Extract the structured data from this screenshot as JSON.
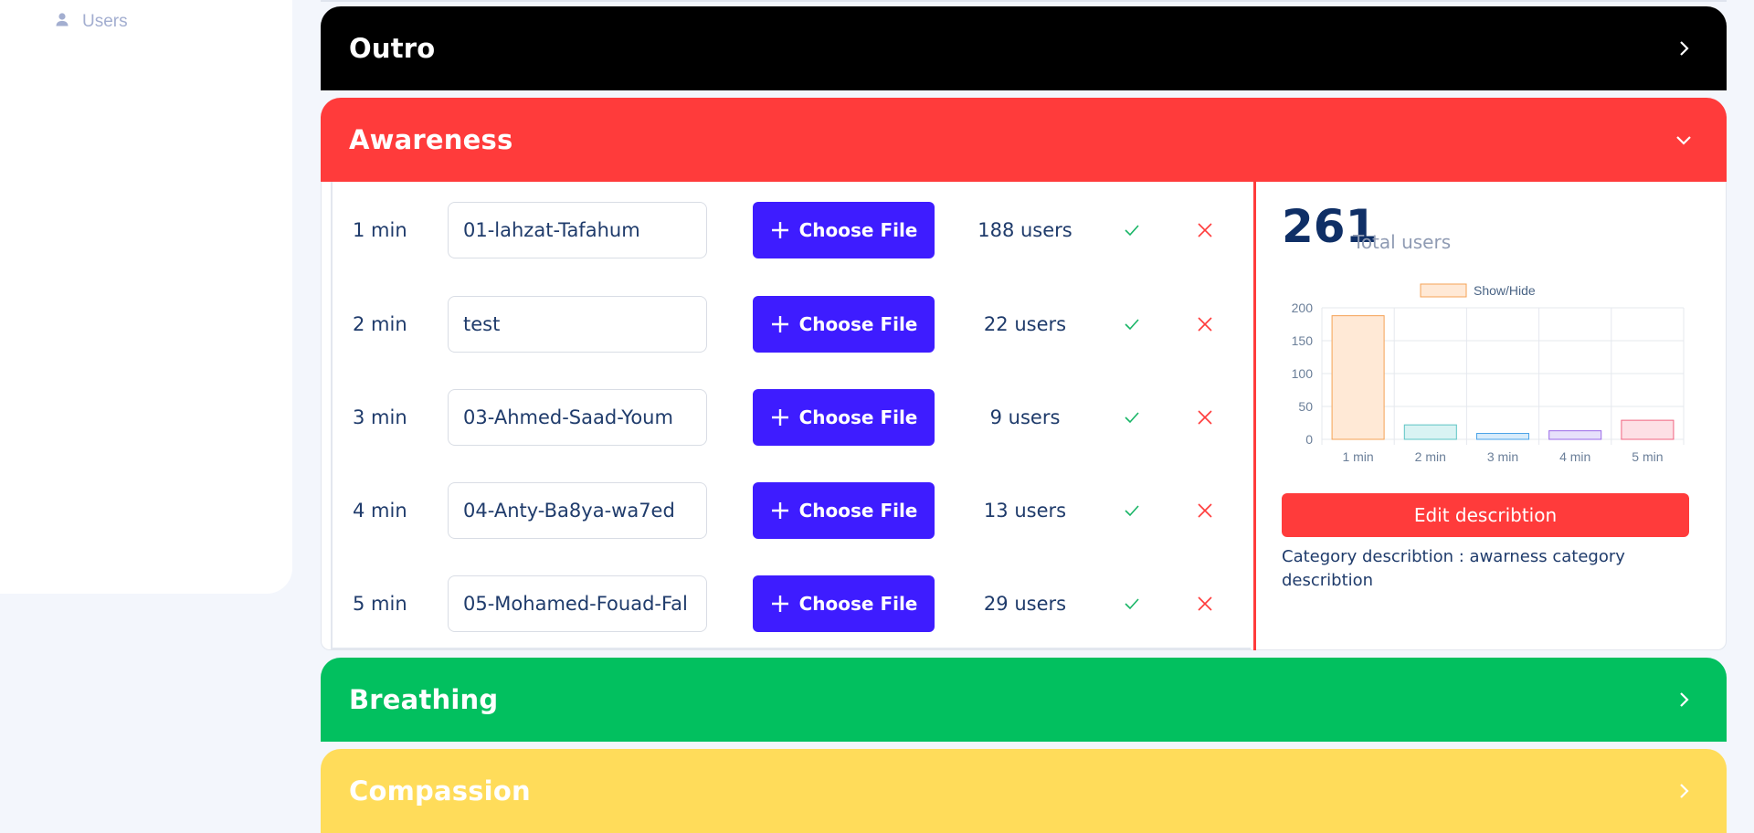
{
  "sidebar": {
    "items": [
      {
        "label": "Users",
        "icon": "user-icon"
      }
    ]
  },
  "sections": {
    "outro": {
      "title": "Outro",
      "color": "#000000"
    },
    "awareness": {
      "title": "Awareness",
      "color": "#ff3b3b"
    },
    "breathing": {
      "title": "Breathing",
      "color": "#02c05f"
    },
    "compassion": {
      "title": "Compassion",
      "color": "#ffdc5a"
    }
  },
  "awareness": {
    "choose_label": "Choose File",
    "rows": [
      {
        "duration": "1 min",
        "file": "01-lahzat-Tafahum",
        "users": "188 users"
      },
      {
        "duration": "2 min",
        "file": "test",
        "users": "22 users"
      },
      {
        "duration": "3 min",
        "file": "03-Ahmed-Saad-Youm",
        "users": "9 users"
      },
      {
        "duration": "4 min",
        "file": "04-Anty-Ba8ya-wa7ed",
        "users": "13 users"
      },
      {
        "duration": "5 min",
        "file": "05-Mohamed-Fouad-Fal",
        "users": "29 users"
      }
    ],
    "total_users": "261",
    "total_label": "Total users",
    "edit_label": "Edit describtion",
    "description": "Category describtion : awarness category describtion"
  },
  "chart_data": {
    "type": "bar",
    "categories": [
      "1 min",
      "2 min",
      "3 min",
      "4 min",
      "5 min"
    ],
    "series": [
      {
        "name": "Show/Hide",
        "values": [
          188,
          22,
          9,
          13,
          29
        ]
      }
    ],
    "ylim": [
      0,
      200
    ],
    "yticks": [
      0,
      50,
      100,
      150,
      200
    ],
    "legend": "top",
    "grid": true,
    "colors": {
      "fill": [
        "#ffe9d6",
        "#d9f3f3",
        "#d8ecfb",
        "#e7e0fb",
        "#fde0e5"
      ],
      "stroke": [
        "#f5a255",
        "#5cc4c4",
        "#4aa3e8",
        "#9a6ae8",
        "#f06480"
      ]
    }
  }
}
